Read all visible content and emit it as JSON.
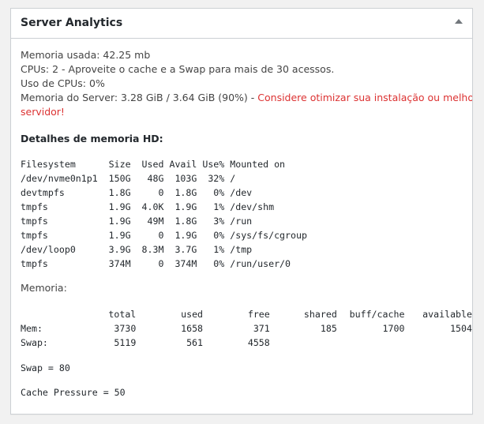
{
  "widget": {
    "title": "Server Analytics"
  },
  "summary": {
    "memory_used": "Memoria usada: 42.25 mb",
    "cpus": "CPUs: 2 - Aproveite o cache e a Swap para mais de 30 acessos.",
    "cpu_usage": "Uso de CPUs: 0%",
    "server_memory_prefix": "Memoria do Server: 3.28 GiB / 3.64 GiB (90%) - ",
    "server_memory_warning_1": "Considere otimizar sua instalação ou melhorar o",
    "server_memory_warning_2": "servidor!"
  },
  "disk": {
    "heading": "Detalhes de memoria HD:",
    "header": "Filesystem      Size  Used Avail Use% Mounted on",
    "rows": [
      "/dev/nvme0n1p1  150G   48G  103G  32% /",
      "devtmpfs        1.8G     0  1.8G   0% /dev",
      "tmpfs           1.9G  4.0K  1.9G   1% /dev/shm",
      "tmpfs           1.9G   49M  1.8G   3% /run",
      "tmpfs           1.9G     0  1.9G   0% /sys/fs/cgroup",
      "/dev/loop0      3.9G  8.3M  3.7G   1% /tmp",
      "tmpfs           374M     0  374M   0% /run/user/0"
    ]
  },
  "memory": {
    "label": "Memoria:",
    "columns": [
      "total",
      "used",
      "free",
      "shared",
      "buff/cache",
      "available"
    ],
    "rows": [
      {
        "name": "Mem:",
        "values": [
          "3730",
          "1658",
          "371",
          "185",
          "1700",
          "1504"
        ]
      },
      {
        "name": "Swap:",
        "values": [
          "5119",
          "561",
          "4558",
          "",
          "",
          ""
        ]
      }
    ]
  },
  "config": {
    "swappiness": "Swap = 80",
    "cache_pressure": "Cache Pressure = 50"
  }
}
